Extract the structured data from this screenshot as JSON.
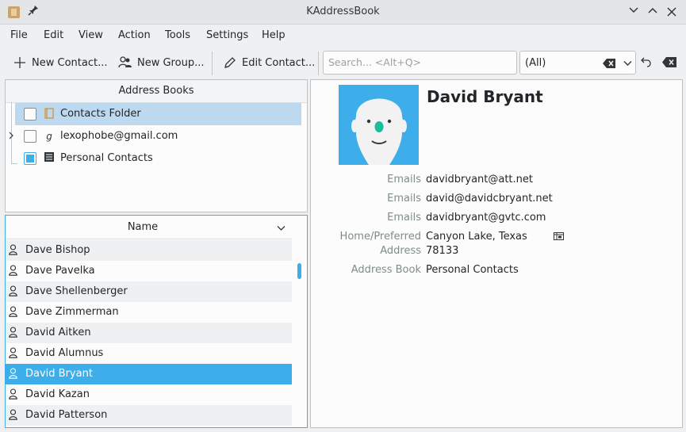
{
  "window": {
    "title": "KAddressBook"
  },
  "menu": [
    "File",
    "Edit",
    "View",
    "Action",
    "Tools",
    "Settings",
    "Help"
  ],
  "toolbar": {
    "new_contact": "New Contact...",
    "new_group": "New Group...",
    "edit_contact": "Edit Contact...",
    "search_placeholder": "Search... <Alt+Q>",
    "filter_value": "(All)"
  },
  "address_books": {
    "header": "Address Books",
    "items": [
      {
        "label": "Contacts Folder",
        "icon": "folder-icon",
        "checked": false,
        "selected": true
      },
      {
        "label": "lexophobe@gmail.com",
        "icon": "google-icon",
        "checked": false,
        "selected": false
      },
      {
        "label": "Personal Contacts",
        "icon": "address-book-icon",
        "checked": true,
        "selected": false
      }
    ]
  },
  "contact_list": {
    "header": "Name",
    "items": [
      {
        "name": "Dave Bishop"
      },
      {
        "name": "Dave Pavelka"
      },
      {
        "name": "Dave Shellenberger"
      },
      {
        "name": "Dave Zimmerman"
      },
      {
        "name": "David Aitken"
      },
      {
        "name": "David Alumnus"
      },
      {
        "name": "David Bryant",
        "selected": true
      },
      {
        "name": "David Kazan"
      },
      {
        "name": "David Patterson"
      }
    ]
  },
  "contact": {
    "name": "David Bryant",
    "fields": {
      "email_label_1": "Emails",
      "email_1": "davidbryant@att.net",
      "email_label_2": "Emails",
      "email_2": "david@davidcbryant.net",
      "email_label_3": "Emails",
      "email_3": "davidbryant@gvtc.com",
      "address_label_1": "Home/Preferred",
      "address_label_2": "Address",
      "address_line_1": "Canyon Lake, Texas",
      "address_line_2": "78133",
      "book_label": "Address Book",
      "book_value": "Personal Contacts"
    }
  },
  "colors": {
    "accent": "#3daee9",
    "selection_light": "#bdd9f0",
    "label": "#7f8c8d"
  }
}
